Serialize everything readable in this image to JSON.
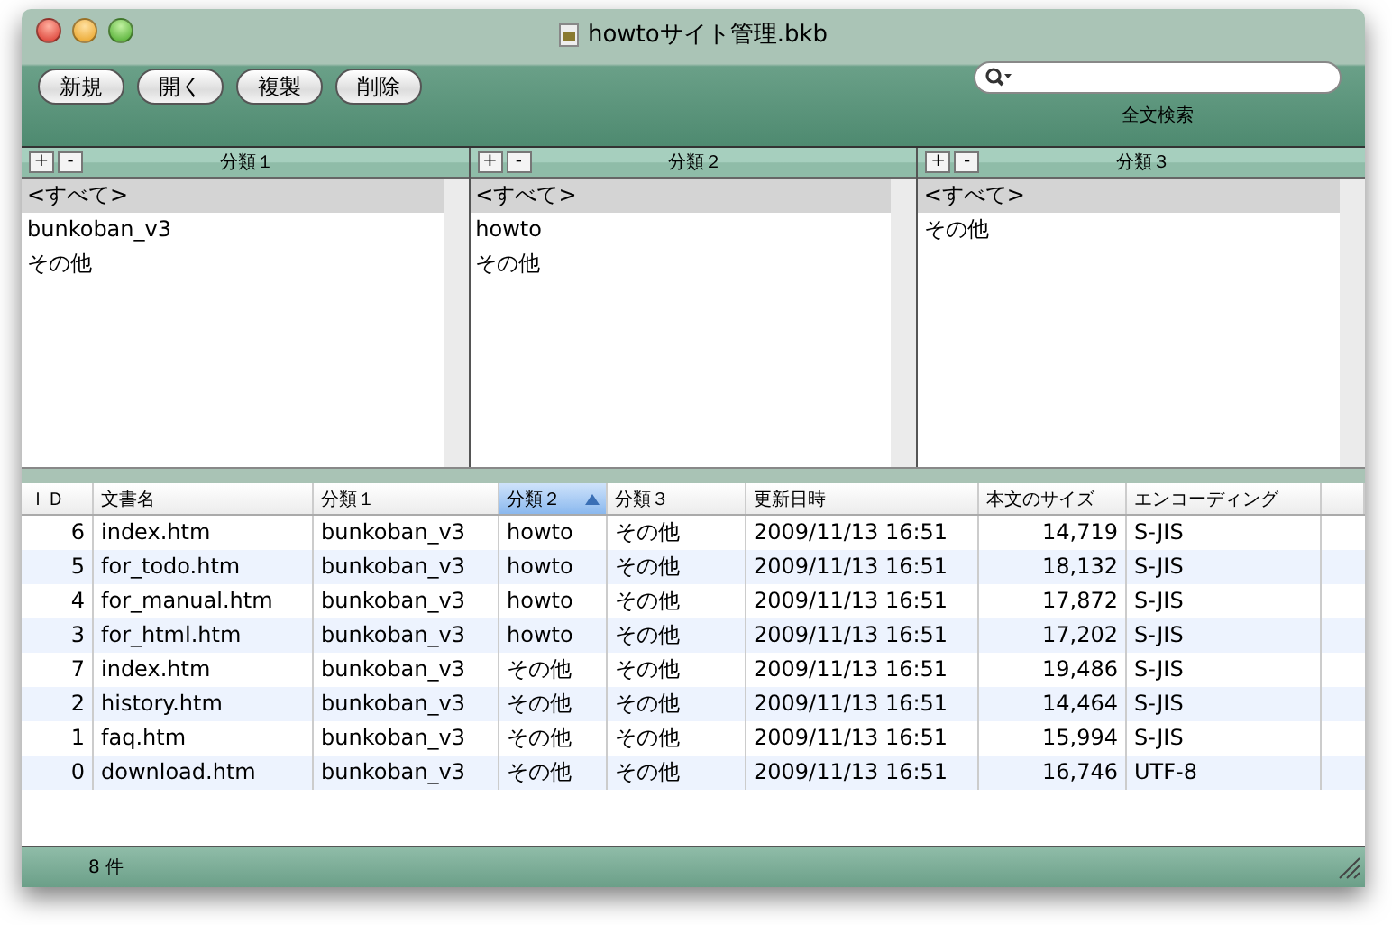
{
  "window": {
    "title": "howtoサイト管理.bkb"
  },
  "toolbar": {
    "buttons": [
      "新規",
      "開く",
      "複製",
      "削除"
    ],
    "search": {
      "label": "全文検索"
    }
  },
  "panes": [
    {
      "title": "分類１",
      "add": "+",
      "remove": "-",
      "items": [
        {
          "label": "<すべて>",
          "selected": true
        },
        {
          "label": "bunkoban_v3",
          "selected": false
        },
        {
          "label": "その他",
          "selected": false
        }
      ]
    },
    {
      "title": "分類２",
      "add": "+",
      "remove": "-",
      "items": [
        {
          "label": "<すべて>",
          "selected": true
        },
        {
          "label": "howto",
          "selected": false
        },
        {
          "label": "その他",
          "selected": false
        }
      ]
    },
    {
      "title": "分類３",
      "add": "+",
      "remove": "-",
      "items": [
        {
          "label": "<すべて>",
          "selected": true
        },
        {
          "label": "その他",
          "selected": false
        }
      ]
    }
  ],
  "table": {
    "columns": [
      {
        "label": "ＩＤ",
        "sorted": false
      },
      {
        "label": "文書名",
        "sorted": false
      },
      {
        "label": "分類１",
        "sorted": false
      },
      {
        "label": "分類２",
        "sorted": true
      },
      {
        "label": "分類３",
        "sorted": false
      },
      {
        "label": "更新日時",
        "sorted": false
      },
      {
        "label": "本文のサイズ",
        "sorted": false
      },
      {
        "label": "エンコーディング",
        "sorted": false
      }
    ],
    "rows": [
      [
        "6",
        "index.htm",
        "bunkoban_v3",
        "howto",
        "その他",
        "2009/11/13 16:51",
        "14,719",
        "S-JIS"
      ],
      [
        "5",
        "for_todo.htm",
        "bunkoban_v3",
        "howto",
        "その他",
        "2009/11/13 16:51",
        "18,132",
        "S-JIS"
      ],
      [
        "4",
        "for_manual.htm",
        "bunkoban_v3",
        "howto",
        "その他",
        "2009/11/13 16:51",
        "17,872",
        "S-JIS"
      ],
      [
        "3",
        "for_html.htm",
        "bunkoban_v3",
        "howto",
        "その他",
        "2009/11/13 16:51",
        "17,202",
        "S-JIS"
      ],
      [
        "7",
        "index.htm",
        "bunkoban_v3",
        "その他",
        "その他",
        "2009/11/13 16:51",
        "19,486",
        "S-JIS"
      ],
      [
        "2",
        "history.htm",
        "bunkoban_v3",
        "その他",
        "その他",
        "2009/11/13 16:51",
        "14,464",
        "S-JIS"
      ],
      [
        "1",
        "faq.htm",
        "bunkoban_v3",
        "その他",
        "その他",
        "2009/11/13 16:51",
        "15,994",
        "S-JIS"
      ],
      [
        "0",
        "download.htm",
        "bunkoban_v3",
        "その他",
        "その他",
        "2009/11/13 16:51",
        "16,746",
        "UTF-8"
      ]
    ]
  },
  "status_bar": {
    "count": "8 件"
  }
}
